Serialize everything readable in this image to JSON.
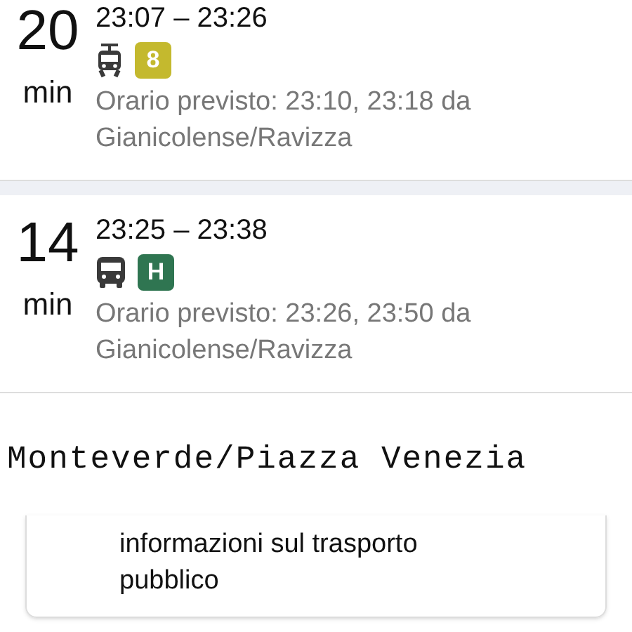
{
  "journeys": [
    {
      "minutes": "20",
      "unit": "min",
      "times": "23:07 – 23:26",
      "kind": "tram",
      "line": "8",
      "color": "#c4b92e",
      "scheduled": "Orario previsto: 23:10, 23:18 da Gianicolense/Ravizza"
    },
    {
      "minutes": "14",
      "unit": "min",
      "times": "23:25 – 23:38",
      "kind": "bus",
      "line": "H",
      "color": "#2f7551",
      "scheduled": "Orario previsto: 23:26, 23:50 da Gianicolense/Ravizza"
    }
  ],
  "route_title": "Monteverde/Piazza Venezia",
  "info_card": {
    "text": "informazioni sul trasporto pubblico"
  }
}
